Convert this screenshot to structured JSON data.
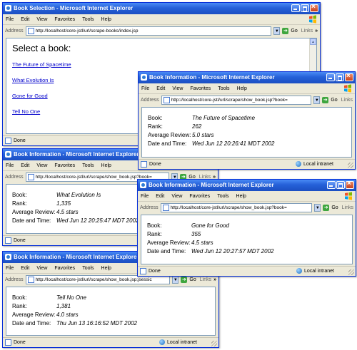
{
  "menu": [
    "File",
    "Edit",
    "View",
    "Favorites",
    "Tools",
    "Help"
  ],
  "address_label": "Address",
  "go_label": "Go",
  "links_label": "Links",
  "chevron": "»",
  "done_label": "Done",
  "intranet_label": "Local intranet",
  "field_labels": {
    "book": "Book:",
    "rank": "Rank:",
    "review": "Average Review:",
    "datetime": "Date and Time:"
  },
  "windows": {
    "selection": {
      "title": "Book Selection - Microsoft Internet Explorer",
      "url": "http://localhost/core-jstl/url/scrape-books/index.jsp",
      "heading": "Select a book:",
      "links": [
        "The Future of Spacetime",
        "What Evolution Is",
        "Gone for Good",
        "Tell No One"
      ]
    },
    "info1": {
      "title": "Book Information - Microsoft Internet Explorer",
      "url": "http://localhost/core-jstl/url/scrape/show_book.jsp?book=",
      "book": "The Future of Spacetime",
      "rank": "262",
      "review": "5.0 stars",
      "datetime": "Wed Jun 12 20:26:41 MDT 2002"
    },
    "info2": {
      "title": "Book Information - Microsoft Internet Explorer",
      "url": "http://localhost/core-jstl/url/scrape/show_book.jsp?book=",
      "book": "What Evolution Is",
      "rank": "1,335",
      "review": "4.5 stars",
      "datetime": "Wed Jun 12 20:25:47 MDT 2002"
    },
    "info3": {
      "title": "Book Information - Microsoft Internet Explorer",
      "url": "http://localhost/core-jstl/url/scrape/show_book.jsp?book=",
      "book": "Gone for Good",
      "rank": "355",
      "review": "4.5 stars",
      "datetime": "Wed Jun 12 20:27:57 MDT 2002"
    },
    "info4": {
      "title": "Book Information - Microsoft Internet Explorer",
      "url": "http://localhost/core-jstl/url/scrape/show_book.jsp;jsessic",
      "book": "Tell No One",
      "rank": "1,381",
      "review": "4.0 stars",
      "datetime": "Thu Jun 13 16:16:52 MDT 2002"
    }
  }
}
